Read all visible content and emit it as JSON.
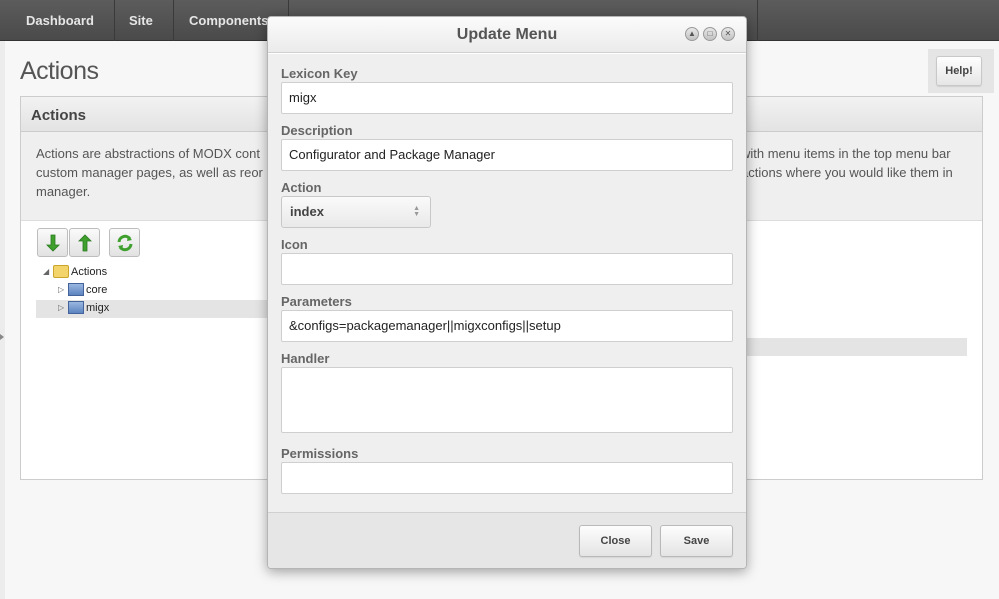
{
  "nav": {
    "items": [
      "Dashboard",
      "Site",
      "Components"
    ]
  },
  "page": {
    "title": "Actions",
    "help_label": "Help!"
  },
  "panel": {
    "title": "Actions",
    "desc_line1_left": "Actions are abstractions of MODX cont",
    "desc_line1_right": "with menu items in the top menu bar",
    "desc_line2_left": "custom manager pages, as well as reor",
    "desc_line2_right": "actions where you would like them in",
    "desc_line3": "manager."
  },
  "toolbar": {
    "down_icon": "arrow-down-icon",
    "up_icon": "arrow-up-icon",
    "refresh_icon": "refresh-icon"
  },
  "tree": {
    "root": "Actions",
    "children": [
      "core",
      "migx"
    ]
  },
  "modal": {
    "title": "Update Menu",
    "fields": {
      "lexicon_key_label": "Lexicon Key",
      "lexicon_key_value": "migx",
      "description_label": "Description",
      "description_value": "Configurator and Package Manager",
      "action_label": "Action",
      "action_value": "index",
      "icon_label": "Icon",
      "icon_value": "",
      "parameters_label": "Parameters",
      "parameters_value": "&configs=packagemanager||migxconfigs||setup",
      "handler_label": "Handler",
      "handler_value": "",
      "permissions_label": "Permissions",
      "permissions_value": ""
    },
    "close_label": "Close",
    "save_label": "Save"
  },
  "colors": {
    "nav_bg": "#4f4f4f",
    "modal_body_bg": "#efefef",
    "icon_green": "#3a9a2a"
  }
}
